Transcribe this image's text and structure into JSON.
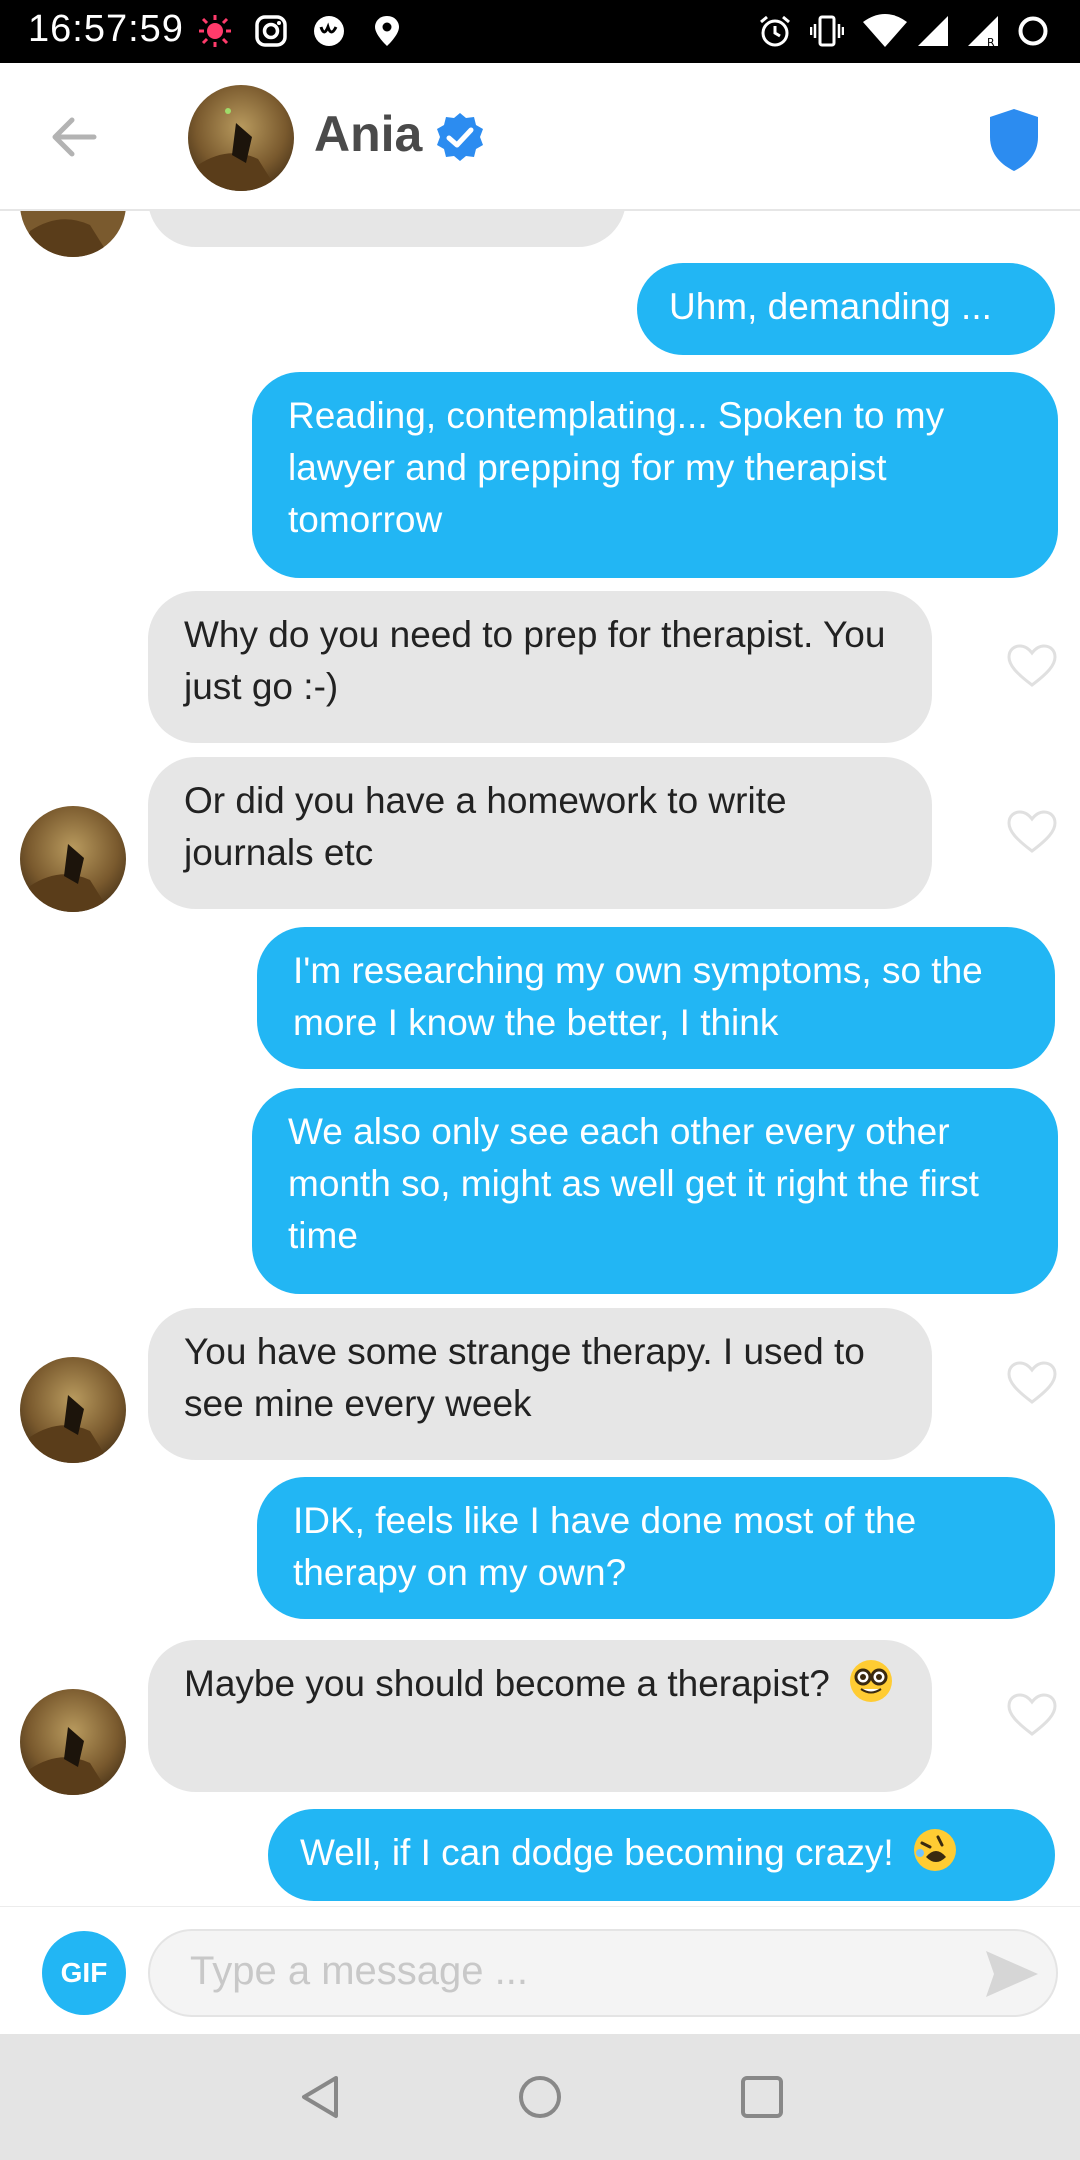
{
  "status_bar": {
    "time": "16:57:59"
  },
  "header": {
    "contact_name": "Ania",
    "verified": true,
    "icons": [
      "back-arrow-icon",
      "verified-badge-icon",
      "shield-icon"
    ]
  },
  "messages": [
    {
      "side": "received",
      "text": "",
      "note": "partially visible bubble at top"
    },
    {
      "side": "sent",
      "text": "Uhm, demanding ..."
    },
    {
      "side": "sent",
      "text": "Reading, contemplating... Spoken to my lawyer and prepping for my therapist tomorrow"
    },
    {
      "side": "received",
      "text": "Why do you need to prep for therapist. You just go :-)"
    },
    {
      "side": "received",
      "text": "Or did you have a homework to write journals etc"
    },
    {
      "side": "sent",
      "text": "I'm researching my own symptoms, so the more I know the better, I think"
    },
    {
      "side": "sent",
      "text": "We also only see each other every other month so, might as well get it right the first time"
    },
    {
      "side": "received",
      "text": "You have some strange therapy. I used to see mine every week"
    },
    {
      "side": "sent",
      "text": "IDK, feels like I have done most of the therapy on my own?"
    },
    {
      "side": "received",
      "text": "Maybe you should become a therapist?",
      "emoji": "nerd-face-emoji"
    },
    {
      "side": "sent",
      "text": "Well, if I can dodge becoming crazy!",
      "emoji": "rolling-on-floor-laughing-emoji"
    }
  ],
  "input": {
    "gif_label": "GIF",
    "placeholder": "Type a message ..."
  },
  "colors": {
    "sent_bubble": "#22b6f4",
    "received_bubble": "#e6e6e6",
    "verified_blue": "#2c8cf0"
  }
}
